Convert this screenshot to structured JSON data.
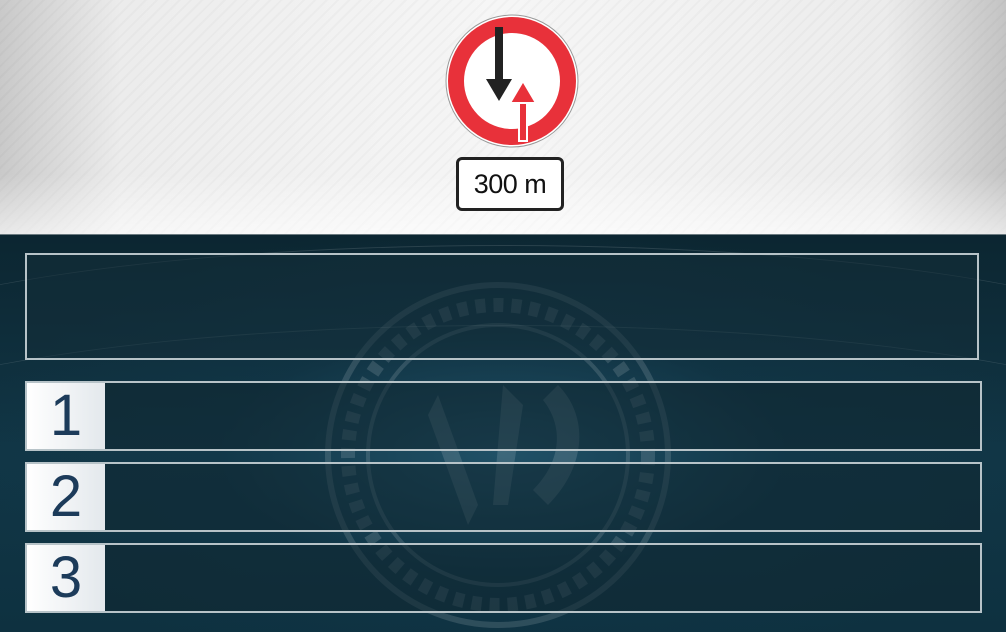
{
  "sign": {
    "icon": "priority-to-oncoming-traffic-sign",
    "distance_plate": "300 m",
    "colors": {
      "ring": "#e8313a",
      "arrow_black": "#222222",
      "arrow_red": "#e8313a"
    }
  },
  "question": {
    "text": ""
  },
  "answers": [
    {
      "number": "1",
      "text": ""
    },
    {
      "number": "2",
      "text": ""
    },
    {
      "number": "3",
      "text": ""
    }
  ],
  "theme": {
    "top_bg": "#f0f0f0",
    "bottom_bg": "#113646",
    "accent_number": "#1c3b5a"
  }
}
